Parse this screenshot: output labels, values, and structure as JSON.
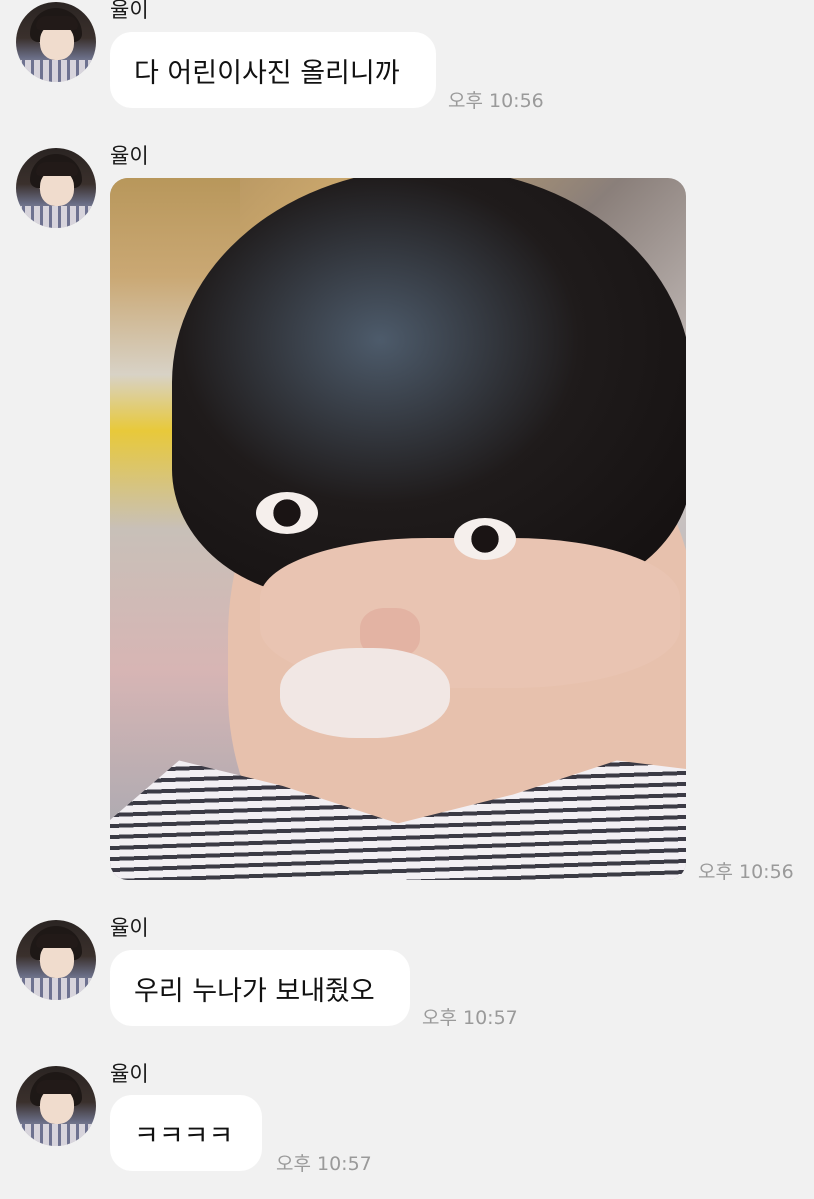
{
  "messages": [
    {
      "sender": "율이",
      "type": "text",
      "text": "다 어린이사진 올리니까",
      "time": "오후 10:56"
    },
    {
      "sender": "율이",
      "type": "image",
      "alt": "",
      "time": "오후 10:56"
    },
    {
      "sender": "율이",
      "type": "text",
      "text": "우리 누나가 보내줬오",
      "time": "오후 10:57"
    },
    {
      "sender": "율이",
      "type": "text",
      "text": "ㅋㅋㅋㅋ",
      "time": "오후 10:57"
    }
  ],
  "colors": {
    "background": "#f1f1f1",
    "bubble": "#ffffff",
    "time": "#9a9a9a"
  },
  "icons": {
    "avatar": "profile-photo"
  }
}
